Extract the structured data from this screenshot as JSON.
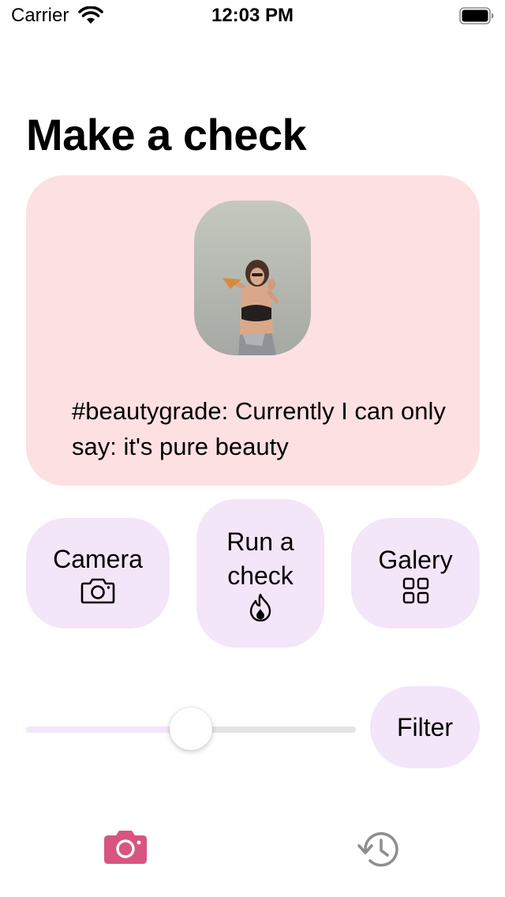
{
  "status_bar": {
    "carrier": "Carrier",
    "time": "12:03 PM"
  },
  "page": {
    "title": "Make a check"
  },
  "result": {
    "text": "#beautygrade: Currently I can only say: it's pure beauty",
    "photo_icon": "woman-photo"
  },
  "actions": {
    "camera": {
      "label": "Camera",
      "icon": "camera-icon"
    },
    "run_check": {
      "label": "Run a check",
      "icon": "flame-icon"
    },
    "gallery": {
      "label": "Galery",
      "icon": "grid-icon"
    }
  },
  "filter": {
    "label": "Filter",
    "slider_value": 0.5
  },
  "tab_bar": {
    "items": [
      {
        "icon": "camera-icon",
        "selected": true
      },
      {
        "icon": "history-icon",
        "selected": false
      }
    ]
  },
  "colors": {
    "card_bg": "#fde0e2",
    "button_bg": "#f3e6f8",
    "accent": "#d85580",
    "inactive": "#8e8e93"
  }
}
